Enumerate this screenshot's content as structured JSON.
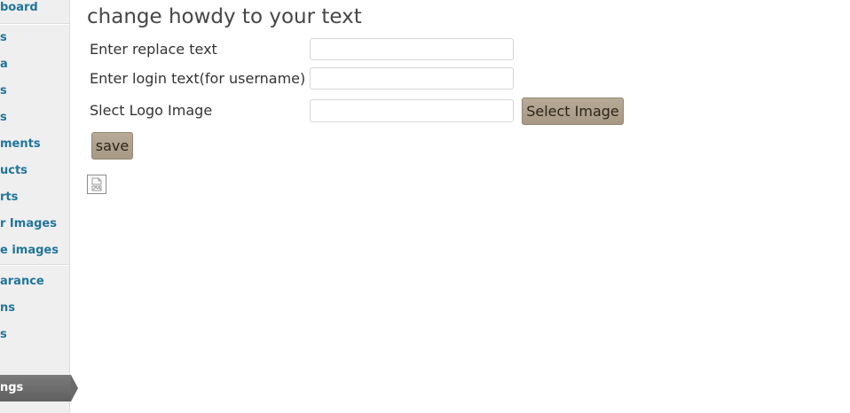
{
  "sidebar": {
    "items": [
      {
        "label": "board"
      },
      {
        "label": "s"
      },
      {
        "label": "a"
      },
      {
        "label": "s"
      },
      {
        "label": "s"
      },
      {
        "label": "ments"
      },
      {
        "label": "ucts"
      },
      {
        "label": "rts"
      },
      {
        "label": "r Images"
      },
      {
        "label": "e images"
      },
      {
        "label": "arance"
      },
      {
        "label": "ns"
      },
      {
        "label": "s"
      }
    ],
    "active_item": {
      "label": "ngs"
    }
  },
  "page": {
    "title": "change howdy to your text"
  },
  "form": {
    "replace_label": "Enter replace text",
    "replace_value": "",
    "login_label": "Enter login text(for username)",
    "login_value": "",
    "logo_label": "Slect Logo Image",
    "logo_value": "",
    "select_image_button": "Select Image",
    "save_button": "save"
  },
  "colors": {
    "link": "#21759b",
    "button": "#b2a591",
    "active_menu": "#6f6f6f"
  }
}
